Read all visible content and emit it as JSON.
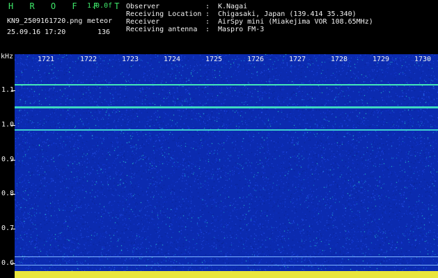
{
  "header": {
    "title": "H R O F F T",
    "version": "1.0.0f",
    "filename": "KN9_2509161720.png",
    "meteor_label": "meteor",
    "timestamp": "25.09.16 17:20",
    "count": "136"
  },
  "info": {
    "observer_label": "Observer",
    "observer_value": "K.Nagai",
    "location_label": "Receiving Location",
    "location_value": "Chigasaki, Japan (139.414 35.340)",
    "receiver_label": "Receiver",
    "receiver_value": "AirSpy mini (Miakejima VOR 108.65MHz)",
    "antenna_label": "Receiving antenna",
    "antenna_value": "Maspro FM-3",
    "separator": ":"
  },
  "axes": {
    "unit": "kHz",
    "time_ticks": [
      "1721",
      "1722",
      "1723",
      "1724",
      "1725",
      "1726",
      "1727",
      "1728",
      "1729",
      "1730"
    ],
    "freq_ticks": [
      "1.1",
      "1.0",
      "0.9",
      "0.8",
      "0.7",
      "0.6"
    ]
  },
  "colors": {
    "background": "#0b2bb0",
    "noise": "#2ff0d0",
    "text": "#f2f2f2",
    "header_green": "#3ee86a",
    "bottom_bar": "#e9e63c"
  }
}
